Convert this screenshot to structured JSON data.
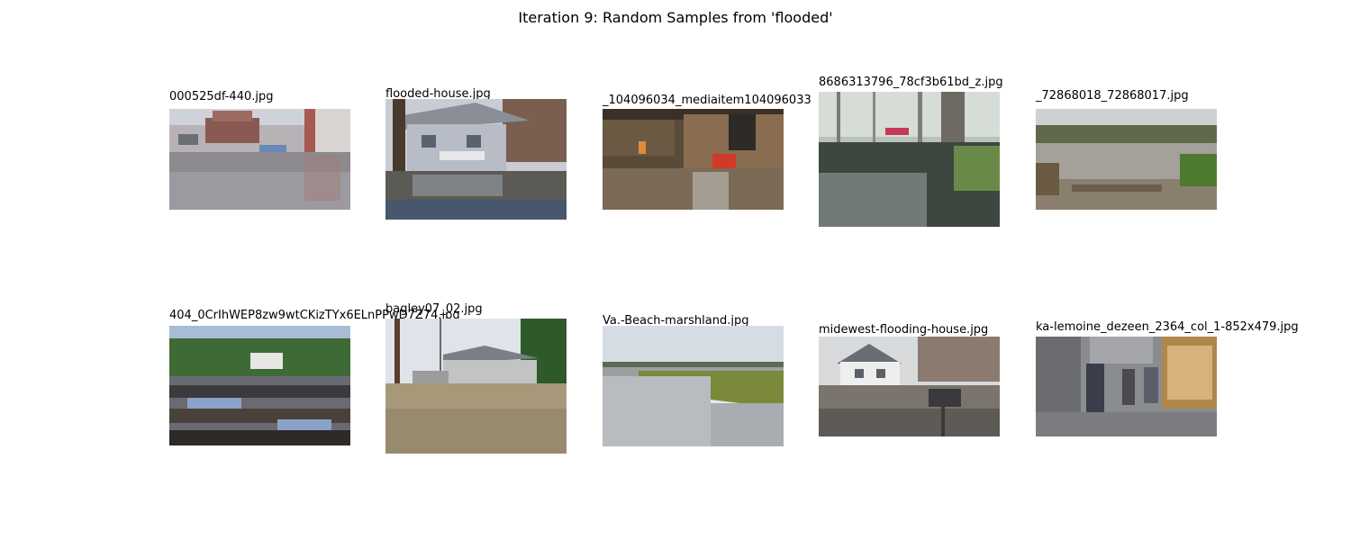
{
  "figure": {
    "title": "Iteration 9: Random Samples from 'flooded'"
  },
  "samples": [
    {
      "filename": "000525df-440.jpg",
      "scene": "flooded-parking-lot-photo"
    },
    {
      "filename": "flooded-house.jpg",
      "scene": "flooded-house-photo"
    },
    {
      "filename": "_104096034_mediaitem104096033",
      "scene": "flooded-shop-photo"
    },
    {
      "filename": "8686313796_78cf3b61bd_z.jpg",
      "scene": "flooded-forest-photo"
    },
    {
      "filename": "_72868018_72868017.jpg",
      "scene": "flooded-field-photo"
    },
    {
      "filename": "404_0CrIhWEP8zw9wtCKizTYx6ELnPPwD7Z74.jpg",
      "scene": "flooded-stumps-photo"
    },
    {
      "filename": "bagley07_02.jpg",
      "scene": "flooded-street-house-photo"
    },
    {
      "filename": "Va.-Beach-marshland.jpg",
      "scene": "marshland-photo"
    },
    {
      "filename": "midewest-flooding-house.jpg",
      "scene": "flooded-white-house-photo"
    },
    {
      "filename": "ka-lemoine_dezeen_2364_col_1-852x479.jpg",
      "scene": "flooded-arcade-photo"
    }
  ]
}
